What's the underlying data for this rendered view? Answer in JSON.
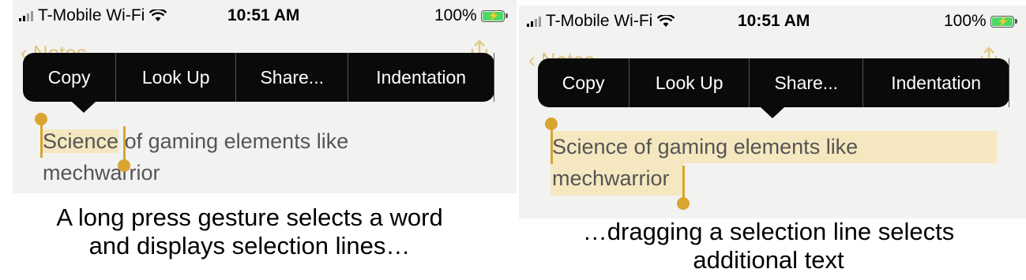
{
  "left": {
    "status": {
      "carrier": "T-Mobile Wi-Fi",
      "time": "10:51 AM",
      "battery": "100%"
    },
    "back_label": "Notes",
    "menu": [
      "Copy",
      "Look Up",
      "Share...",
      "Indentation"
    ],
    "note": {
      "word1": "Science",
      "rest1": " of gaming elements like",
      "line2": "mechwarrior"
    },
    "caption": {
      "line1": "A long press gesture selects a word",
      "line2": "and displays selection lines…"
    }
  },
  "right": {
    "status": {
      "carrier": "T-Mobile Wi-Fi",
      "time": "10:51 AM",
      "battery": "100%"
    },
    "back_label": "Notes",
    "menu": [
      "Copy",
      "Look Up",
      "Share...",
      "Indentation"
    ],
    "note": {
      "line1": "Science of gaming elements like",
      "line2": "mechwarrior"
    },
    "caption": {
      "line1": "…dragging a selection line selects",
      "line2": "additional text"
    }
  },
  "colors": {
    "accent": "#d9a531",
    "highlight": "#f5e7bf",
    "menu_bg": "#0a0a0a",
    "battery": "#4cd964"
  }
}
